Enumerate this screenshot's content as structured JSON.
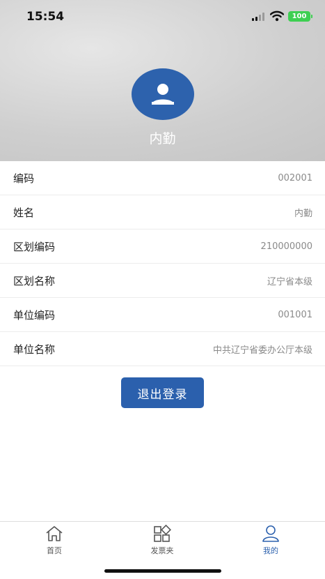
{
  "status_bar": {
    "time": "15:54",
    "battery": "100"
  },
  "profile": {
    "name": "内勤",
    "avatar_icon": "user-icon"
  },
  "info_rows": [
    {
      "label": "编码",
      "value": "002001"
    },
    {
      "label": "姓名",
      "value": "内勤"
    },
    {
      "label": "区划编码",
      "value": "210000000"
    },
    {
      "label": "区划名称",
      "value": "辽宁省本级"
    },
    {
      "label": "单位编码",
      "value": "001001"
    },
    {
      "label": "单位名称",
      "value": "中共辽宁省委办公厅本级"
    }
  ],
  "logout_label": "退出登录",
  "tabs": [
    {
      "label": "首页",
      "icon": "home-icon",
      "active": false
    },
    {
      "label": "发票夹",
      "icon": "apps-icon",
      "active": false
    },
    {
      "label": "我的",
      "icon": "person-icon",
      "active": true
    }
  ],
  "colors": {
    "accent": "#2b60ad",
    "battery": "#3ecf52"
  }
}
